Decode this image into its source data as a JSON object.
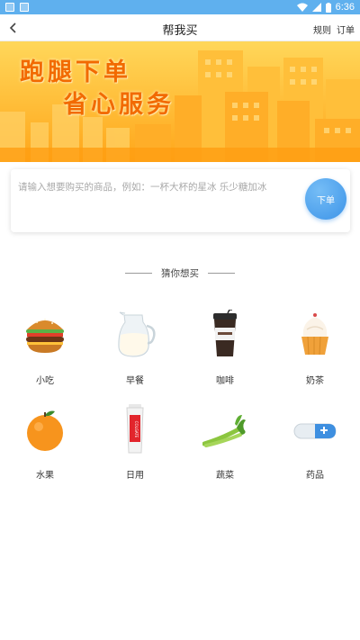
{
  "status_bar": {
    "time": "6:36"
  },
  "nav": {
    "title": "帮我买",
    "rules_label": "规则",
    "orders_label": "订单"
  },
  "banner": {
    "line1": "跑腿下单",
    "line2": "省心服务"
  },
  "order": {
    "placeholder": "请输入想要购买的商品，例如：一杯大杯的星冰 乐少糖加冰",
    "value": "",
    "submit_label": "下单"
  },
  "section": {
    "title": "猜你想买"
  },
  "categories": [
    {
      "label": "小吃",
      "icon": "burger-icon"
    },
    {
      "label": "早餐",
      "icon": "milk-jug-icon"
    },
    {
      "label": "咖啡",
      "icon": "coffee-cup-icon"
    },
    {
      "label": "奶茶",
      "icon": "cupcake-icon"
    },
    {
      "label": "水果",
      "icon": "orange-icon"
    },
    {
      "label": "日用",
      "icon": "toothpaste-icon"
    },
    {
      "label": "蔬菜",
      "icon": "celery-icon"
    },
    {
      "label": "药品",
      "icon": "capsule-icon"
    }
  ],
  "colors": {
    "status_bar": "#5fb0ee",
    "banner_bg": "#ffb21e",
    "slogan": "#f26a00",
    "order_button": "#3d94e8"
  }
}
